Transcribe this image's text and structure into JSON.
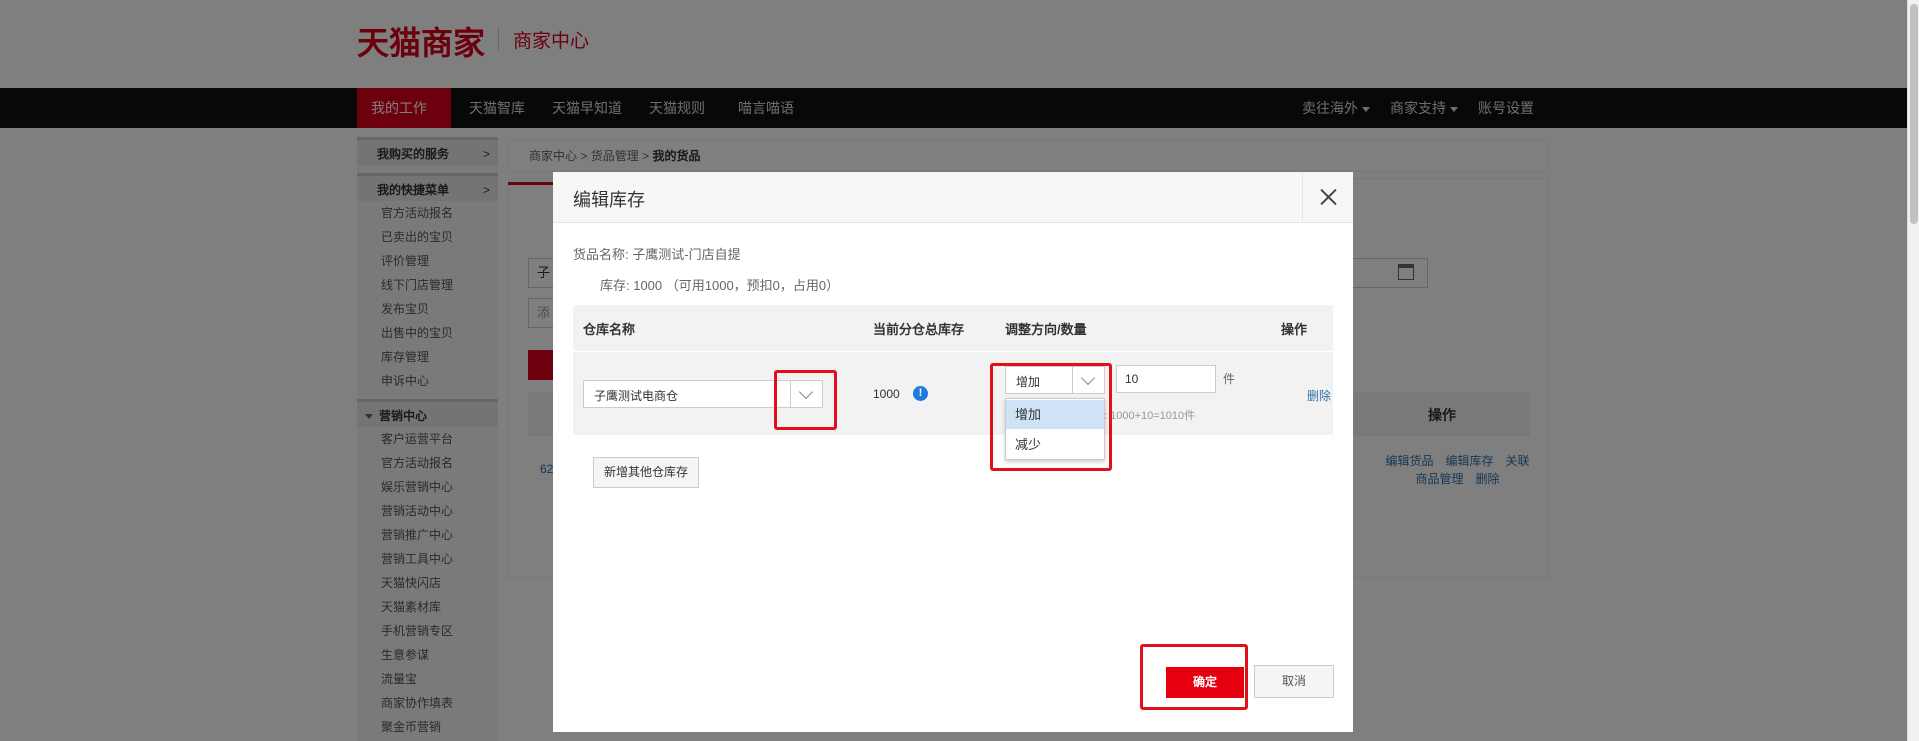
{
  "header": {
    "logo": "天猫商家",
    "subtitle": "商家中心"
  },
  "nav": {
    "items": [
      "我的工作台",
      "天猫智库",
      "天猫早知道",
      "天猫规则",
      "喵言喵语"
    ],
    "right_items": [
      "卖往海外",
      "商家支持",
      "账号设置"
    ]
  },
  "sidebar": {
    "bought_services": "我购买的服务",
    "shortcut_menu": "我的快捷菜单",
    "arrow": ">",
    "shortcut_links": [
      "官方活动报名",
      "已卖出的宝贝",
      "评价管理",
      "线下门店管理",
      "发布宝贝",
      "出售中的宝贝",
      "库存管理",
      "申诉中心"
    ],
    "marketing_center": "营销中心",
    "marketing_links": [
      "客户运营平台",
      "官方活动报名",
      "娱乐营销中心",
      "营销活动中心",
      "营销推广中心",
      "营销工具中心",
      "天猫快闪店",
      "天猫素材库",
      "手机营销专区",
      "生意参谋",
      "流量宝",
      "商家协作填表",
      "聚金币营销"
    ]
  },
  "breadcrumb": {
    "part1": "商家中心",
    "sep": ">",
    "part2": "货品管理",
    "part3": "我的货品"
  },
  "background": {
    "input_prefix": "子",
    "add_prefix": "添",
    "operation_header": "操作",
    "row_number": "62",
    "row_links_line1": "编辑货品　编辑库存　关联",
    "row_links_line2": "商品管理　删除"
  },
  "modal": {
    "title": "编辑库存",
    "goods_name_label": "货品名称:",
    "goods_name": "子鹰测试-门店自提",
    "stock_line": "库存:  1000 （可用1000，预扣0，占用0）",
    "columns": [
      "仓库名称",
      "当前分仓总库存",
      "调整方向/数量",
      "操作"
    ],
    "row": {
      "warehouse": "子鹰测试电商仓",
      "current_stock": "1000",
      "info_icon": "!",
      "direction": "增加",
      "quantity": "10",
      "unit": "件",
      "hint": "存:  1000+10=1010件",
      "delete": "删除"
    },
    "direction_options": [
      "增加",
      "减少"
    ],
    "add_warehouse": "新增其他仓库存",
    "confirm": "确定",
    "cancel": "取消"
  },
  "colors": {
    "brand_red": "#d9001b",
    "highlight_red": "#e0101a",
    "link_blue": "#3071a9",
    "info_blue": "#1f7ae0"
  }
}
